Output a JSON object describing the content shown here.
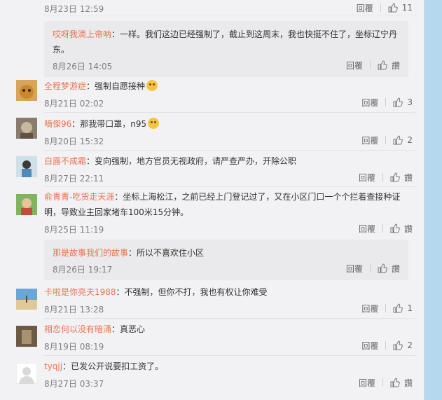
{
  "top": {
    "time": "8月23日 12:59",
    "reply": "回覆",
    "likes": "11"
  },
  "sub1": {
    "name": "哎呀我滴上帝呐",
    "text": "：一样。我们这边已经强制了，截止到这周末，我也快挺不住了，坐标辽宁丹东。",
    "time": "8月26日 14:05",
    "reply": "回覆",
    "likes": "讚"
  },
  "comments": [
    {
      "name": "全程梦游症",
      "text": "：强制自愿接种",
      "time": "8月21日 02:02",
      "reply": "回覆",
      "likes": "3",
      "emoji": "grinning-cat-emoji"
    },
    {
      "name": "嘀傑96",
      "text": "：那我带口罩，n95",
      "time": "8月20日 15:32",
      "reply": "回覆",
      "likes": "2",
      "emoji": "hush-emoji"
    },
    {
      "name": "白露不成霜",
      "text": "：变向强制，地方官员无视政府，请严查严办，开除公职",
      "time": "8月27日 22:11",
      "reply": "回覆",
      "likes": "讚"
    },
    {
      "name": "俞青青-吃货走天涯",
      "text": "：坐标上海松江，之前已经上门登记过了，又在小区门口一个个拦着查接种证明，导致业主回家堵车100米15分钟。",
      "time": "8月25日 11:19",
      "reply": "回覆",
      "likes": "讚"
    },
    {
      "name": "卡啦是你亮夫1988",
      "text": "：不强制，但你不打，我也有权让你难受",
      "time": "8月21日 13:28",
      "reply": "回覆",
      "likes": "1"
    },
    {
      "name": "相恋何以没有暗涌",
      "text": "：真恶心",
      "time": "8月19日 08:19",
      "reply": "回覆",
      "likes": "2"
    },
    {
      "name": "tyqjj",
      "text": "：已发公开说要扣工资了。",
      "time": "8月27日 03:37",
      "reply": "回覆",
      "likes": "讚"
    }
  ],
  "sub2": {
    "name": "那是故事我们的故事",
    "text": "：所以不喜欢住小区",
    "time": "8月26日 19:17",
    "reply": "回覆",
    "likes": "讚"
  }
}
